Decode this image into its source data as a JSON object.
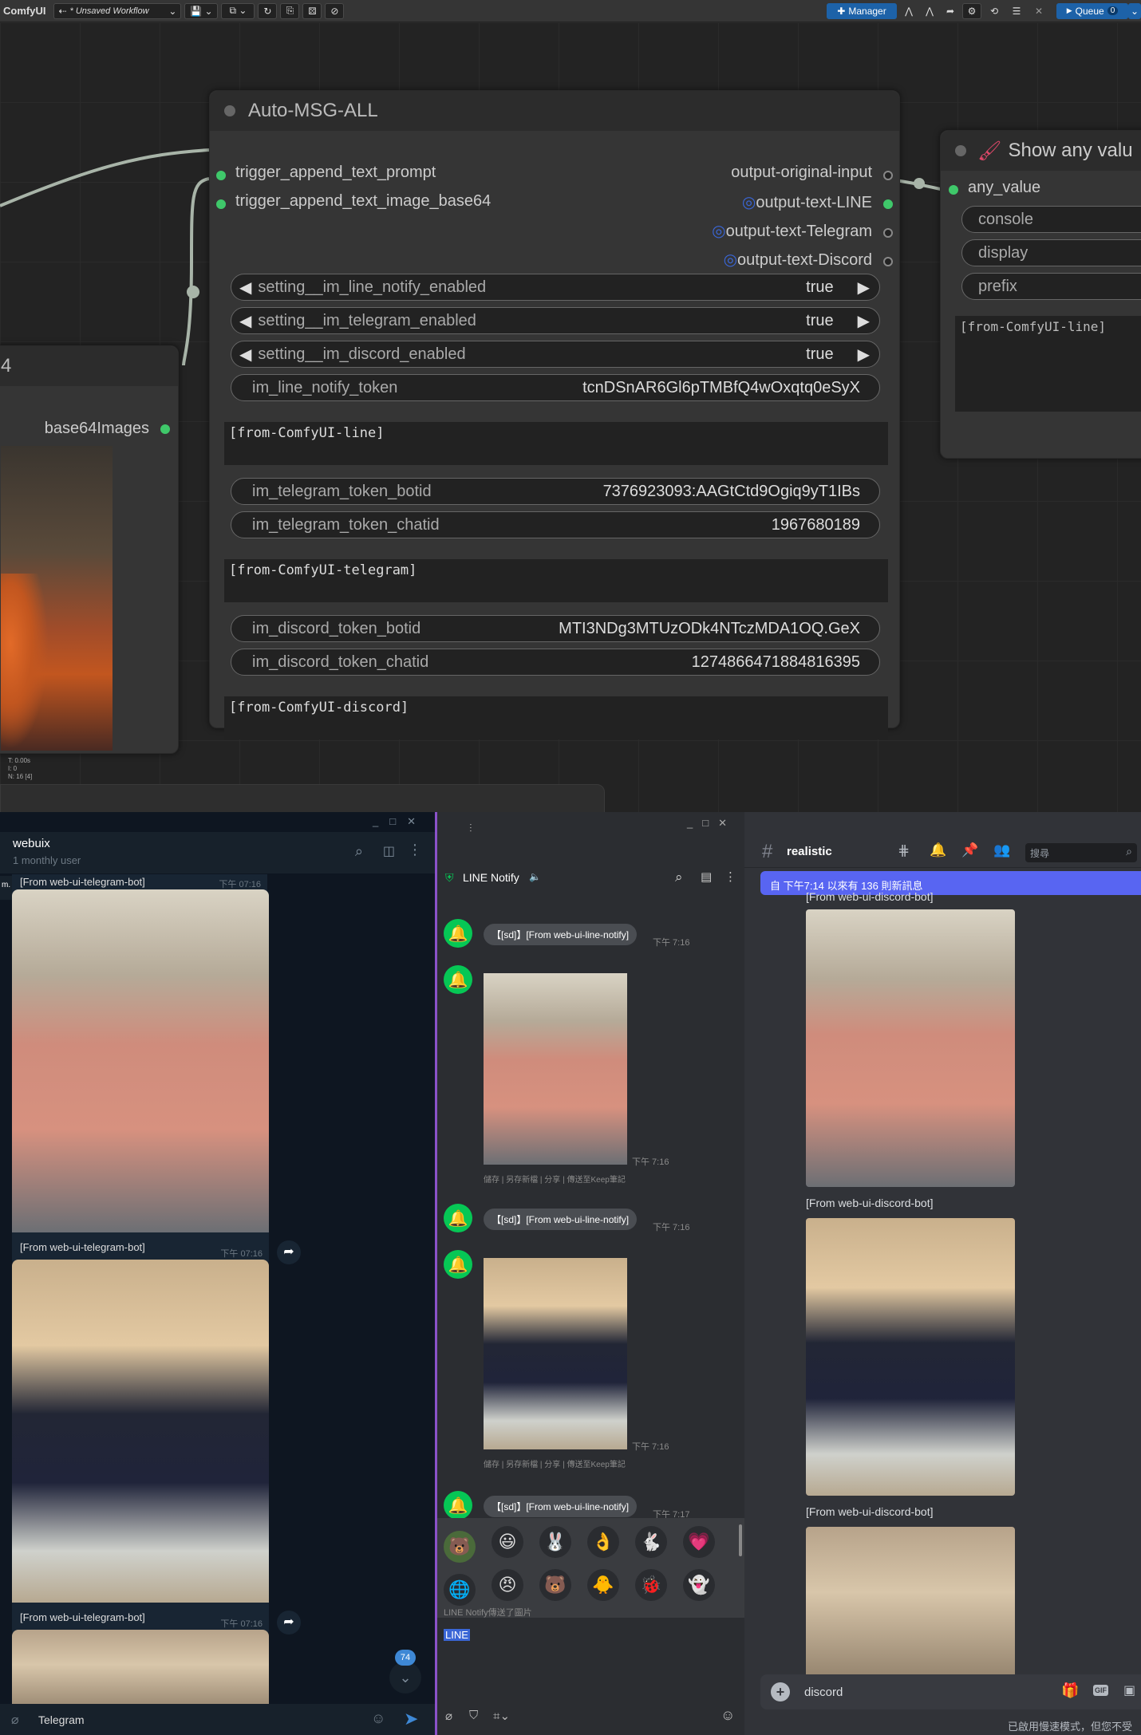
{
  "comfy": {
    "logo": "ComfyUI",
    "workflow": "* Unsaved Workflow",
    "manager": "Manager",
    "queue": "Queue",
    "queue_count": "0",
    "stats": [
      "T: 0.00s",
      "I: 0",
      "N: 16 [4]"
    ]
  },
  "node_main": {
    "title": "Auto-MSG-ALL",
    "inputs": [
      "trigger_append_text_prompt",
      "trigger_append_text_image_base64"
    ],
    "outputs": [
      "output-original-input",
      "output-text-LINE",
      "output-text-Telegram",
      "output-text-Discord"
    ],
    "toggles": [
      {
        "name": "setting__im_line_notify_enabled",
        "value": "true"
      },
      {
        "name": "setting__im_telegram_enabled",
        "value": "true"
      },
      {
        "name": "setting__im_discord_enabled",
        "value": "true"
      }
    ],
    "line_token": {
      "name": "im_line_notify_token",
      "value": "tcnDSnAR6Gl6pTMBfQ4wOxqtq0eSyX"
    },
    "line_text": "[from-ComfyUI-line]",
    "tg_botid": {
      "name": "im_telegram_token_botid",
      "value": "7376923093:AAGtCtd9Ogiq9yT1IBs"
    },
    "tg_chatid": {
      "name": "im_telegram_token_chatid",
      "value": "1967680189"
    },
    "tg_text": "[from-ComfyUI-telegram]",
    "dc_botid": {
      "name": "im_discord_token_botid",
      "value": "MTI3NDg3MTUzODk4NTczMDA1OQ.GeX"
    },
    "dc_chatid": {
      "name": "im_discord_token_chatid",
      "value": "1274866471884816395"
    },
    "dc_text": "[from-ComfyUI-discord]"
  },
  "node_left": {
    "title_fragment": "4",
    "output": "base64Images"
  },
  "node_show": {
    "title": "Show any valu",
    "input": "any_value",
    "widgets": [
      "console",
      "display",
      "prefix"
    ],
    "text": "[from-ComfyUI-line]"
  },
  "telegram": {
    "title": "webuix",
    "subtitle": "1 monthly user",
    "top_caption": "[From web-ui-telegram-bot]",
    "time": "下午 07:16",
    "captions": [
      "[From web-ui-telegram-bot]",
      "[From web-ui-telegram-bot]"
    ],
    "badge": "74",
    "input_placeholder": "Telegram",
    "side_fragment": "m."
  },
  "line": {
    "title": "LINE Notify",
    "messages": [
      "【[sd]】[From web-ui-line-notify]",
      "【[sd]】[From web-ui-line-notify]",
      "【[sd]】[From web-ui-line-notify]"
    ],
    "times": [
      "下午 7:16",
      "下午 7:16",
      "下午 7:16",
      "下午 7:16",
      "下午 7:17"
    ],
    "actions": "儲存 | 另存新檔 | 分享 | 傳送至Keep筆記",
    "preview": "LINE Notify傳送了圖片",
    "input_text": "LINE"
  },
  "discord": {
    "channel": "realistic",
    "search_placeholder": "搜尋",
    "banner": "自 下午7:14 以來有 136 則新訊息",
    "top_caption": "[From web-ui-discord-bot]",
    "captions": [
      "[From web-ui-discord-bot]",
      "[From web-ui-discord-bot]"
    ],
    "input_text": "discord",
    "footer": "已啟用慢速模式，但您不受"
  }
}
